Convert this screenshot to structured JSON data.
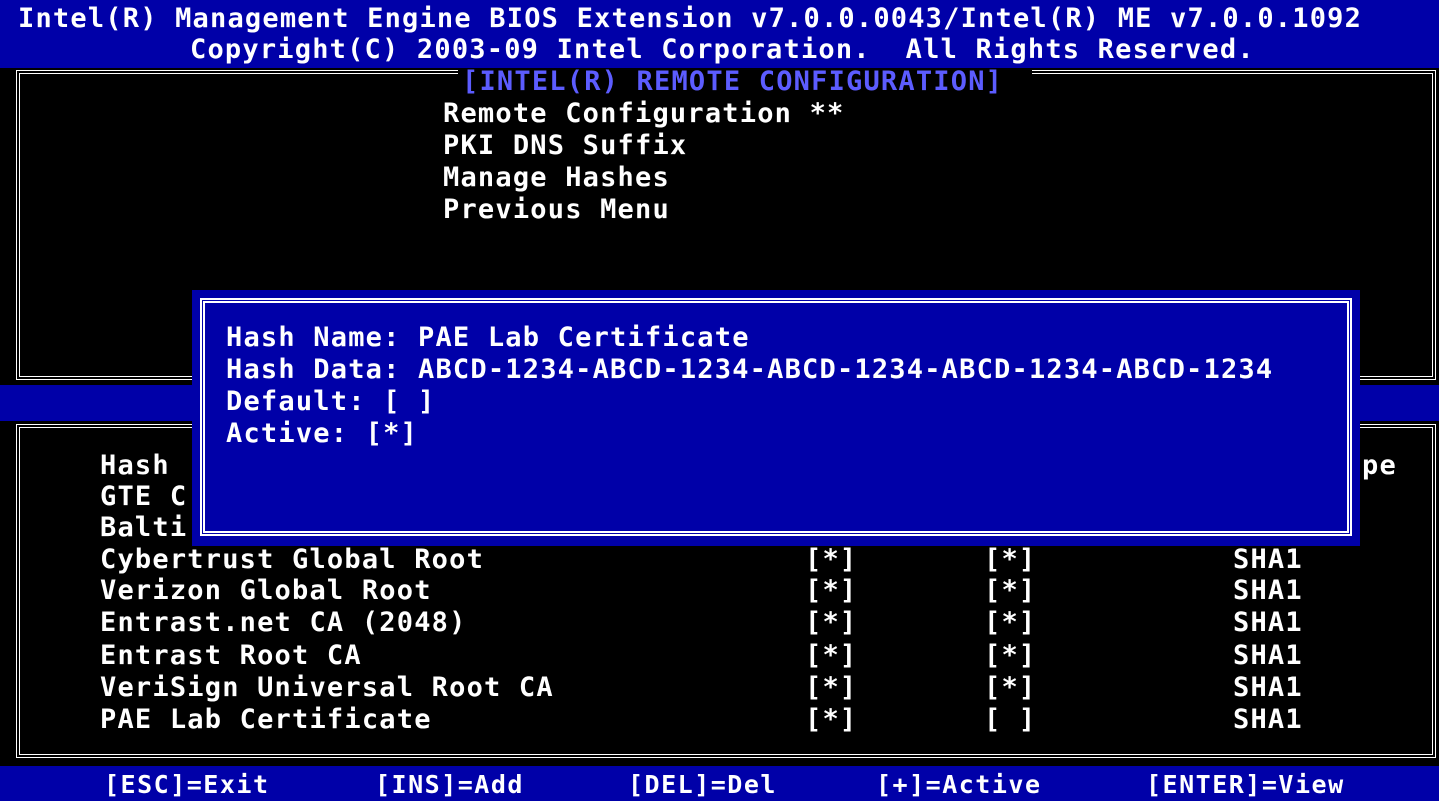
{
  "header": {
    "line1": "Intel(R) Management Engine BIOS Extension v7.0.0.0043/Intel(R) ME v7.0.0.1092",
    "line2": "Copyright(C) 2003-09 Intel Corporation.  All Rights Reserved."
  },
  "menu": {
    "title": "[INTEL(R) REMOTE CONFIGURATION]",
    "items": [
      {
        "label": "Remote Configuration **"
      },
      {
        "label": "PKI DNS Suffix"
      },
      {
        "label": "Manage Hashes"
      },
      {
        "label": "Previous Menu"
      }
    ]
  },
  "hash_table": {
    "header_partial_left": "Hash",
    "header_partial_right": "pe",
    "partial_rows": [
      {
        "name": "GTE C"
      },
      {
        "name": "Balti"
      }
    ],
    "rows": [
      {
        "name": "Cybertrust Global Root",
        "default": "[*]",
        "active": "[*]",
        "type": "SHA1"
      },
      {
        "name": "Verizon Global Root",
        "default": "[*]",
        "active": "[*]",
        "type": "SHA1"
      },
      {
        "name": "Entrast.net CA (2048)",
        "default": "[*]",
        "active": "[*]",
        "type": "SHA1"
      },
      {
        "name": "Entrast Root CA",
        "default": "[*]",
        "active": "[*]",
        "type": "SHA1"
      },
      {
        "name": "VeriSign Universal Root CA",
        "default": "[*]",
        "active": "[*]",
        "type": "SHA1"
      },
      {
        "name": "PAE Lab Certificate",
        "default": "[*]",
        "active": "[ ]",
        "type": "SHA1"
      }
    ]
  },
  "dialog": {
    "hash_name": "Hash Name: PAE Lab Certificate",
    "hash_data": "Hash Data: ABCD-1234-ABCD-1234-ABCD-1234-ABCD-1234-ABCD-1234",
    "default": "Default: [ ]",
    "active": "Active: [*]"
  },
  "footer": {
    "items": [
      {
        "label": "[ESC]=Exit"
      },
      {
        "label": "[INS]=Add"
      },
      {
        "label": "[DEL]=Del"
      },
      {
        "label": "[+]=Active"
      },
      {
        "label": "[ENTER]=View"
      }
    ]
  },
  "colors": {
    "bios_blue": "#0000a8",
    "title_blue": "#5c5cff",
    "text": "#ffffff",
    "background": "#000000"
  }
}
